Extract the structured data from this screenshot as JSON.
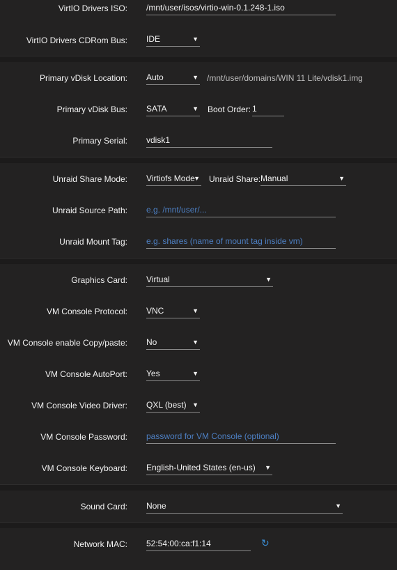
{
  "virtio": {
    "iso_label": "VirtIO Drivers ISO:",
    "iso_value": "/mnt/user/isos/virtio-win-0.1.248-1.iso",
    "cdrom_label": "VirtIO Drivers CDRom Bus:",
    "cdrom_value": "IDE"
  },
  "vdisk": {
    "location_label": "Primary vDisk Location:",
    "location_value": "Auto",
    "location_path": "/mnt/user/domains/WIN 11 Lite/vdisk1.img",
    "bus_label": "Primary vDisk Bus:",
    "bus_value": "SATA",
    "boot_order_label": "Boot Order:",
    "boot_order_value": "1",
    "serial_label": "Primary Serial:",
    "serial_value": "vdisk1"
  },
  "share": {
    "mode_label": "Unraid Share Mode:",
    "mode_value": "Virtiofs Mode",
    "share_label": "Unraid Share:",
    "share_value": "Manual",
    "source_label": "Unraid Source Path:",
    "source_placeholder": "e.g. /mnt/user/...",
    "tag_label": "Unraid Mount Tag:",
    "tag_placeholder": "e.g. shares (name of mount tag inside vm)"
  },
  "graphics": {
    "card_label": "Graphics Card:",
    "card_value": "Virtual",
    "protocol_label": "VM Console Protocol:",
    "protocol_value": "VNC",
    "copy_label": "VM Console enable Copy/paste:",
    "copy_value": "No",
    "autoport_label": "VM Console AutoPort:",
    "autoport_value": "Yes",
    "video_label": "VM Console Video Driver:",
    "video_value": "QXL (best)",
    "password_label": "VM Console Password:",
    "password_placeholder": "password for VM Console (optional)",
    "keyboard_label": "VM Console Keyboard:",
    "keyboard_value": "English-United States (en-us)"
  },
  "sound": {
    "label": "Sound Card:",
    "value": "None"
  },
  "network": {
    "mac_label": "Network MAC:",
    "mac_value": "52:54:00:ca:f1:14",
    "refresh_icon": "refresh-icon"
  },
  "colors": {
    "background": "#1c1b1b",
    "section": "#232222",
    "placeholder": "#4d7fc2",
    "accent": "#3b8fd6"
  }
}
